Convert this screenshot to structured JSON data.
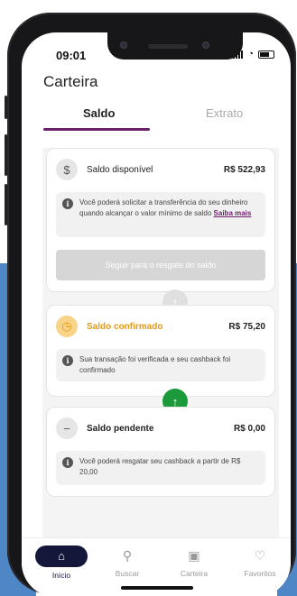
{
  "status": {
    "time": "09:01"
  },
  "header": {
    "title": "Carteira"
  },
  "tabs": [
    {
      "label": "Saldo"
    },
    {
      "label": "Extrato"
    }
  ],
  "cards": {
    "disponivel": {
      "label": "Saldo disponível",
      "amount": "R$ 522,93",
      "info": "Você poderá solicitar a transferência do seu dinheiro quando alcançar o valor mínimo de saldo",
      "link": "Saiba mais",
      "button": "Seguir para o resgate do saldo"
    },
    "confirmado": {
      "label": "Saldo confirmado",
      "amount": "R$ 75,20",
      "info": "Sua transação foi verificada e seu cashback foi confirmado"
    },
    "pendente": {
      "label": "Saldo pendente",
      "amount": "R$ 0,00",
      "info": "Você poderá resgatar seu cashback a partir de R$ 20,00"
    }
  },
  "nav": [
    {
      "label": "Início"
    },
    {
      "label": "Buscar"
    },
    {
      "label": "Carteira"
    },
    {
      "label": "Favoritos"
    }
  ],
  "colors": {
    "accent": "#6b1f6b",
    "confirmed": "#f2b630",
    "green": "#1a9a3a",
    "navActive": "#15173a"
  }
}
